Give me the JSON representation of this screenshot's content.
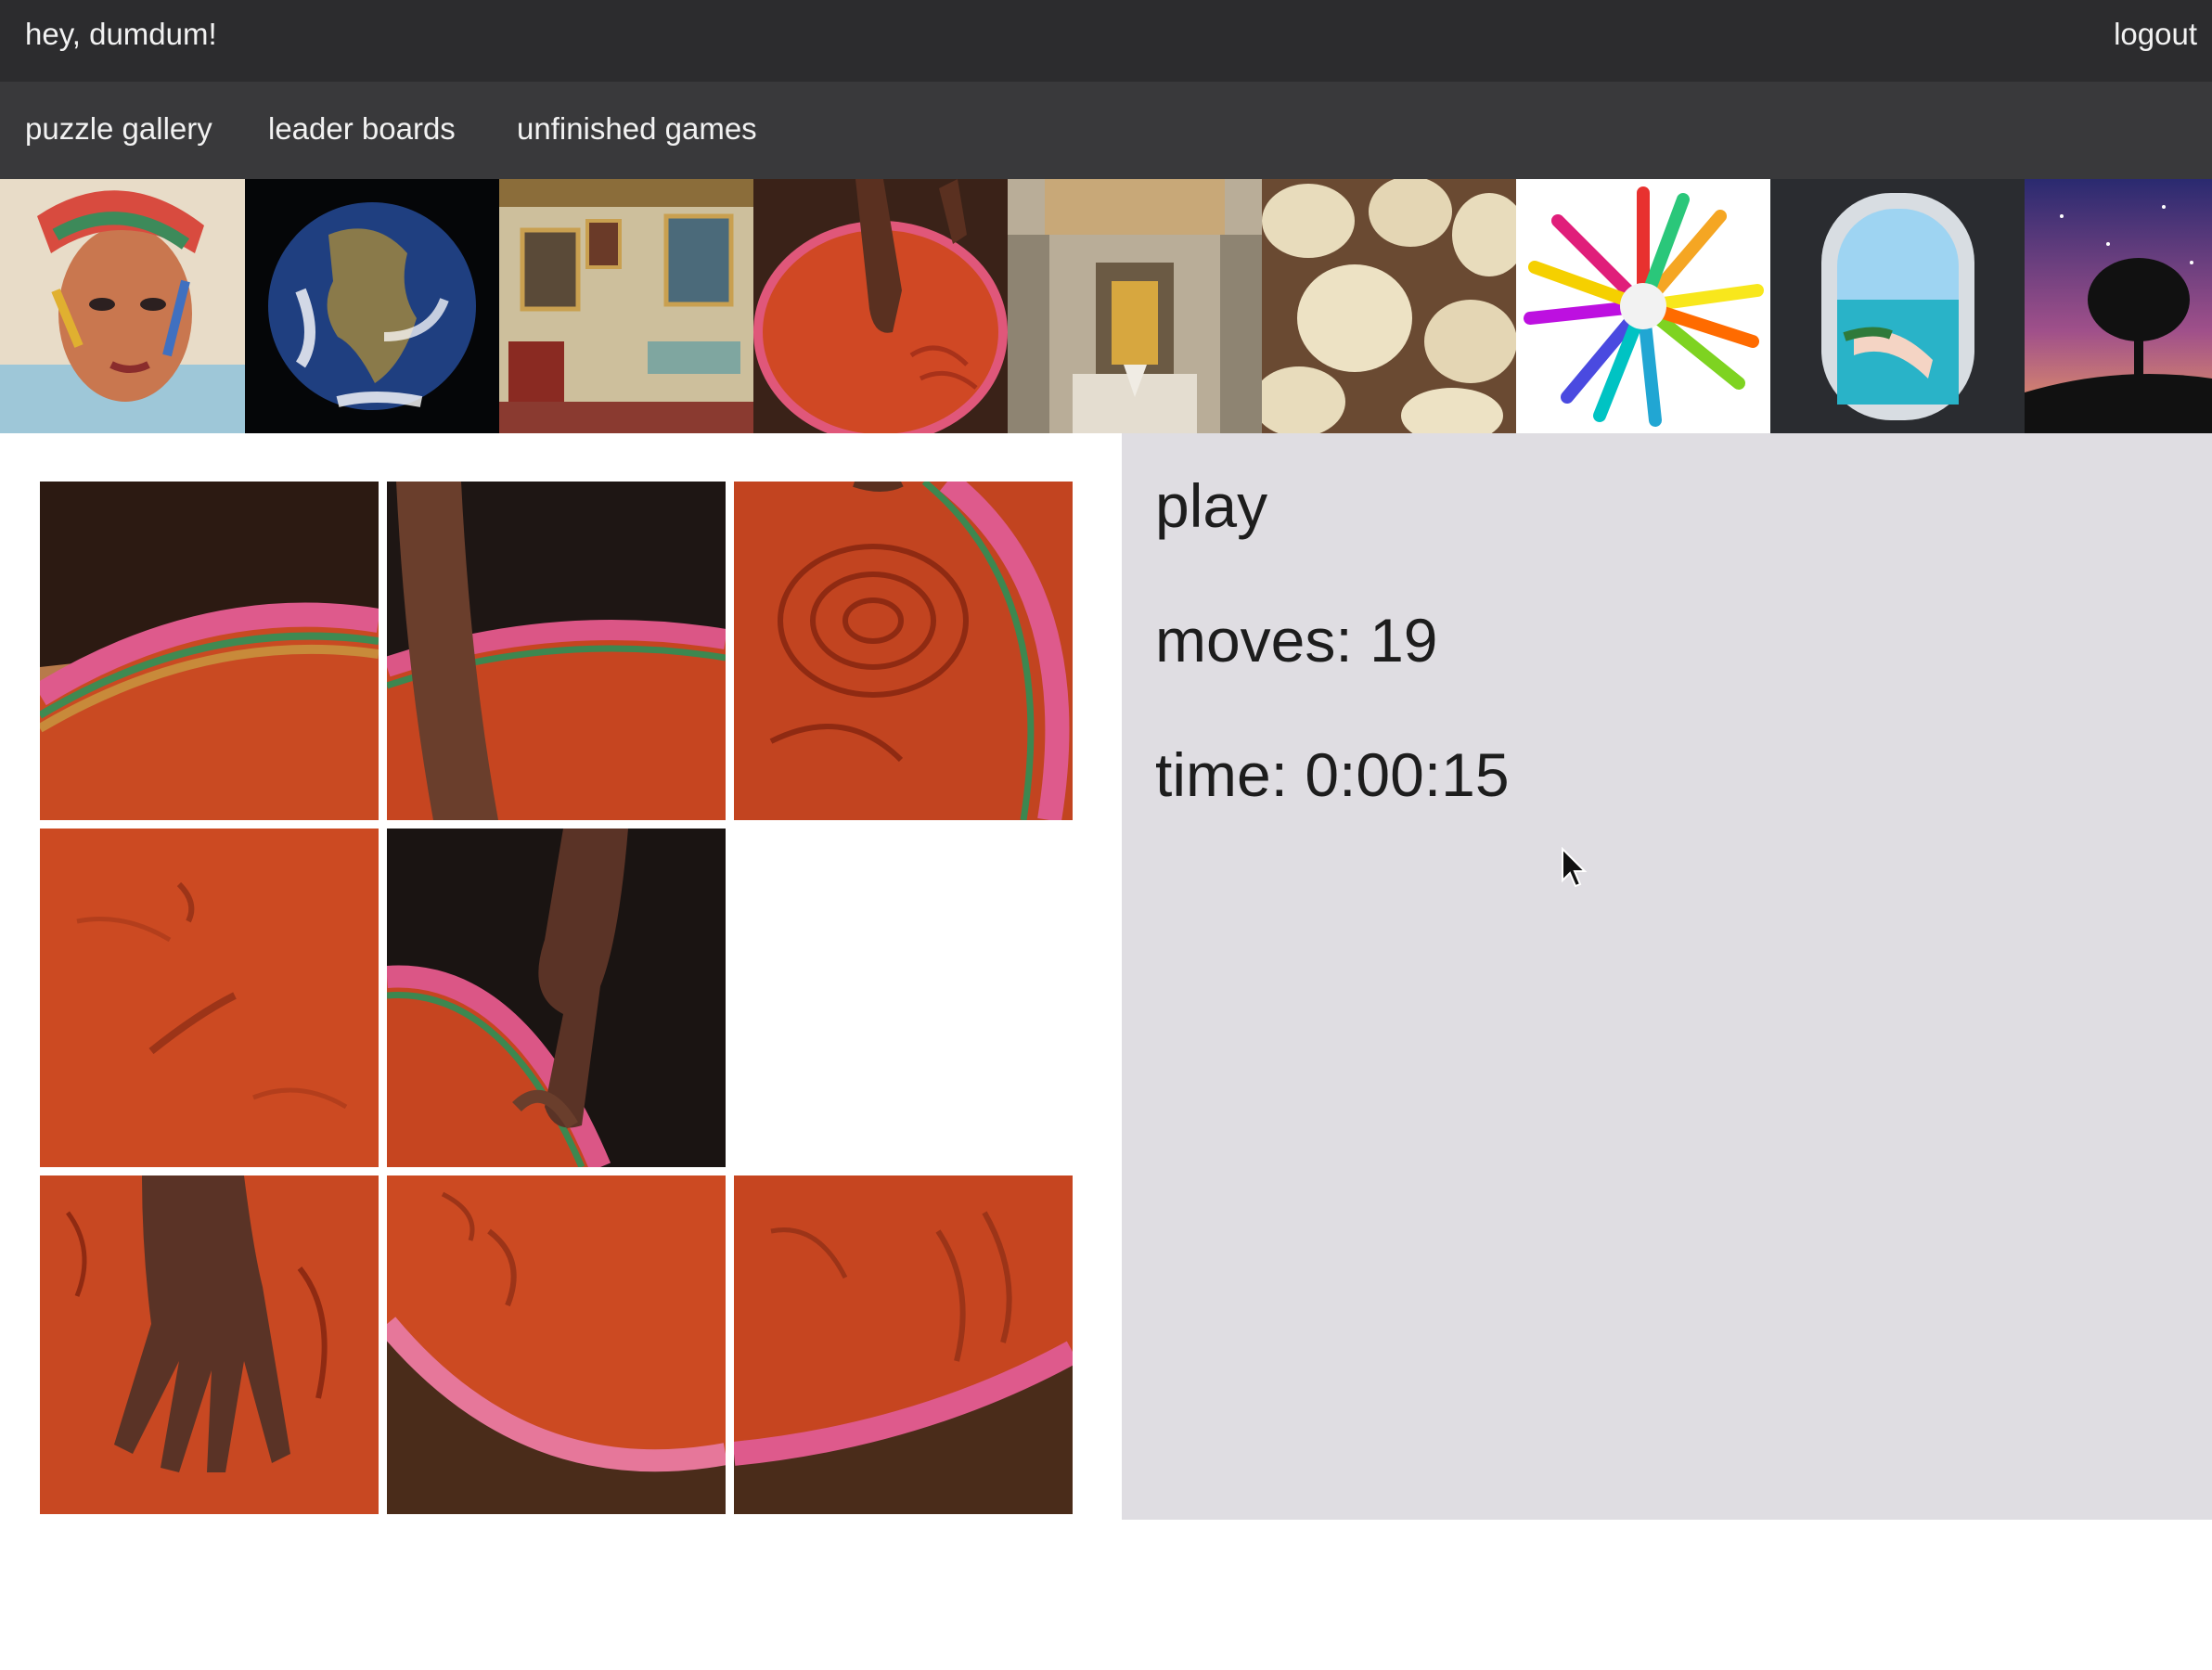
{
  "header": {
    "greeting": "hey, dumdum!",
    "logout_label": "logout"
  },
  "nav": {
    "items": [
      "puzzle gallery",
      "leader boards",
      "unfinished games"
    ]
  },
  "gallery": {
    "thumbnails": [
      {
        "subject": "painted-portrait"
      },
      {
        "subject": "earth-globe"
      },
      {
        "subject": "ornate-room"
      },
      {
        "subject": "red-sand-bowl"
      },
      {
        "subject": "palace-hall"
      },
      {
        "subject": "dumplings"
      },
      {
        "subject": "color-burst"
      },
      {
        "subject": "airplane-window"
      },
      {
        "subject": "tree-night-sky"
      }
    ]
  },
  "puzzle": {
    "grid_rows": 3,
    "grid_cols": 3,
    "empty_slot": 5
  },
  "panel": {
    "title": "play",
    "moves_label": "moves: 19",
    "time_label": "time: 0:00:15"
  }
}
